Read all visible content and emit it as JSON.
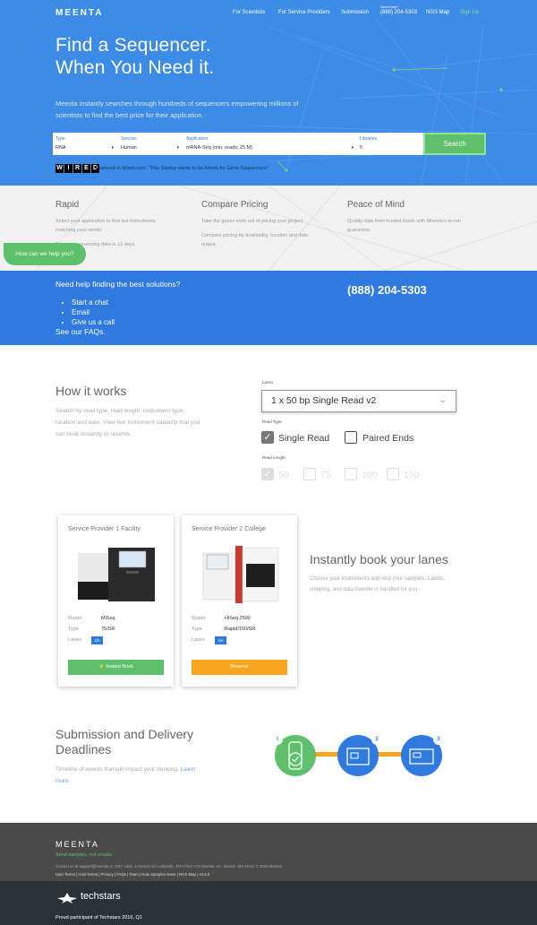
{
  "header": {
    "logo": "MEENTA",
    "nav": [
      "For Scientists",
      "For Service Providers",
      "Submission"
    ],
    "need_help": "Need help?",
    "phone": "(888) 204-5303",
    "ngs_map": "NGS Map",
    "sign_up": "Sign Up"
  },
  "hero": {
    "title_line1": "Find a Sequencer.",
    "title_line2": "When You Need it.",
    "subtitle": "Meenta instantly searches through hundreds of sequencers empowering millions of scientists to find the best price for their application.",
    "fields": [
      {
        "label": "Type",
        "value": "RNA"
      },
      {
        "label": "Species",
        "value": "Human"
      },
      {
        "label": "Application",
        "value": "mRNA-Seq (min. reads: 25 M)"
      },
      {
        "label": "Libraries",
        "value": "5"
      }
    ],
    "search_label": "Search",
    "wired_letters": [
      "W",
      "I",
      "R",
      "E",
      "D"
    ],
    "wired_text": "Featured in Wired.com: \"This Startup wants to be Airbnb for Gene Sequencers\""
  },
  "features": [
    {
      "title": "Rapid",
      "lines": [
        "Select your application to find live instruments",
        "matching your needs.",
        "Receive sequencing data in 12 days."
      ]
    },
    {
      "title": "Compare Pricing",
      "lines": [
        "Take the guess work out of pricing your project.",
        "Compare pricing by availability, location and data",
        "output."
      ]
    },
    {
      "title": "Peace of Mind",
      "lines": [
        "Quality data from trusted Hosts with Meenta's re-run",
        "guarantee."
      ]
    }
  ],
  "chat_bubble": "How can we help you?",
  "help": {
    "title": "Need help finding the best solutions?",
    "items": [
      "Start a chat",
      "Email",
      "Give us a call"
    ],
    "faq": "See our FAQs.",
    "phone": "(888) 204-5303"
  },
  "how": {
    "title": "How it works",
    "text_lines": [
      "Search by read type, read length, instrument type,",
      "location and date. View live instrument capacity that you",
      "can book instantly or reserve."
    ],
    "lanes_label": "Lanes",
    "lanes_value": "1 x 50 bp Single Read v2",
    "read_type_label": "Read Type",
    "single_read": "Single Read",
    "paired_ends": "Paired Ends",
    "read_length_label": "Read Length",
    "read_lengths": [
      "50",
      "75",
      "100",
      "150"
    ]
  },
  "cards": [
    {
      "title": "Service Provider 1 Facility",
      "model_k": "Model",
      "model": "MiSeq",
      "type_k": "Type",
      "type": "75/SR",
      "lanes_k": "Lanes",
      "lanes": "1ln",
      "button": "⚡ Instant Book",
      "button_color": "#5dc06a"
    },
    {
      "title": "Service Provider 2 College",
      "model_k": "Model",
      "model": "HiSeq 2500",
      "type_k": "Type",
      "type": "Rapid/150/SR",
      "lanes_k": "Lanes",
      "lanes": "1ln",
      "button": "Reserve",
      "button_color": "#f7a51c"
    }
  ],
  "book": {
    "title": "Instantly book your lanes",
    "text_lines": [
      "Choose your instruments and ship your samples. Labels,",
      "shipping, and data transfer is handled for you."
    ]
  },
  "deadlines": {
    "title_line1": "Submission and Delivery",
    "title_line2": "Deadlines",
    "text_pre": "Timeline of events that will impact your booking.",
    "link": "Learn",
    "link2": "more",
    "steps": [
      "1",
      "2",
      "3"
    ],
    "step_colors": [
      "#5dc06a",
      "#2e7ae1",
      "#2e7ae1"
    ],
    "connector_color": "#f7a51c"
  },
  "footer": {
    "logo": "MEENTA",
    "tagline": "Send samples, not emails.",
    "contact": "Contact us at support@meenta.io, DSV Labs, 2 Avenue De Lafayette, 4TH Floor C/O Meenta, Inc. Boston, MA 02111 © 2018 Meenta",
    "links": "User Terms | Host Terms | Privacy | FAQs | Team | How Samples Move | NGS Map | v0.5.5",
    "techstars": "techstars",
    "techstars_sub": "Proud participant of Techstars 2016, Q1"
  }
}
